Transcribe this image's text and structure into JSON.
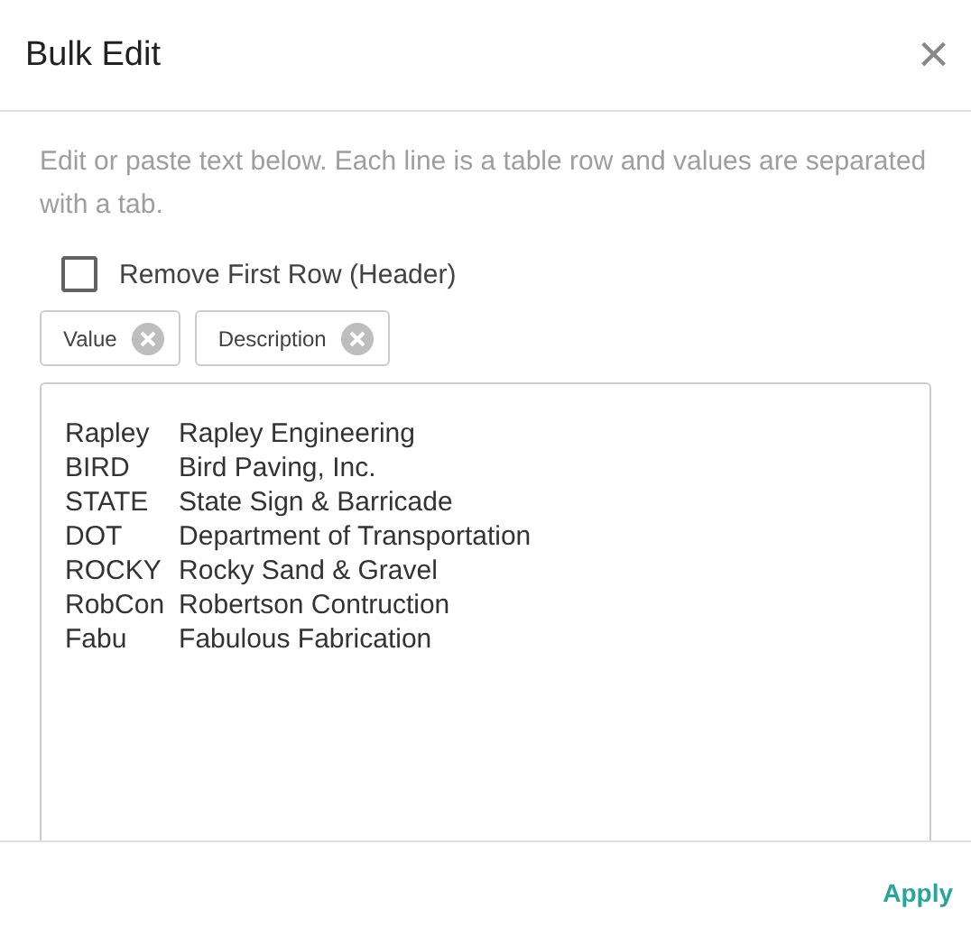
{
  "dialog": {
    "title": "Bulk Edit",
    "close": "×"
  },
  "instructions": "Edit or paste text below. Each line is a table row and values are separated with a tab.",
  "remove_first_row": {
    "label": "Remove First Row (Header)",
    "checked": false
  },
  "columns": [
    {
      "label": "Value"
    },
    {
      "label": "Description"
    }
  ],
  "rows": [
    {
      "value": "Rapley",
      "description": "Rapley Engineering"
    },
    {
      "value": "BIRD",
      "description": "Bird Paving, Inc."
    },
    {
      "value": "STATE",
      "description": "State Sign & Barricade"
    },
    {
      "value": "DOT",
      "description": "Department of Transportation"
    },
    {
      "value": "ROCKY",
      "description": "Rocky Sand & Gravel"
    },
    {
      "value": "RobCon",
      "description": "Robertson Contruction"
    },
    {
      "value": "Fabu",
      "description": "Fabulous Fabrication"
    }
  ],
  "buttons": [
    {
      "label": "Apply"
    }
  ]
}
